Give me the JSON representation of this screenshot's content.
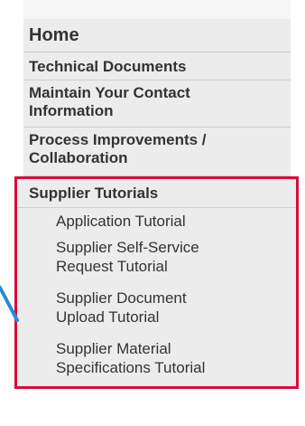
{
  "nav": {
    "home": "Home",
    "technical_documents": "Technical Documents",
    "maintain_contact_line1": "Maintain Your Contact",
    "maintain_contact_line2": "Information",
    "process_line1": "Process Improvements /",
    "process_line2": "Collaboration"
  },
  "supplier_tutorials": {
    "heading": "Supplier Tutorials",
    "items": [
      {
        "line1": "Application Tutorial"
      },
      {
        "line1": "Supplier Self-Service",
        "line2": "Request Tutorial"
      },
      {
        "line1": "Supplier Document",
        "line2": "Upload Tutorial"
      },
      {
        "line1": "Supplier Material",
        "line2": "Specifications Tutorial"
      }
    ]
  },
  "colors": {
    "highlight_border": "#d80c3b",
    "arrow": "#2a8ad6",
    "nav_background": "#ececec"
  }
}
